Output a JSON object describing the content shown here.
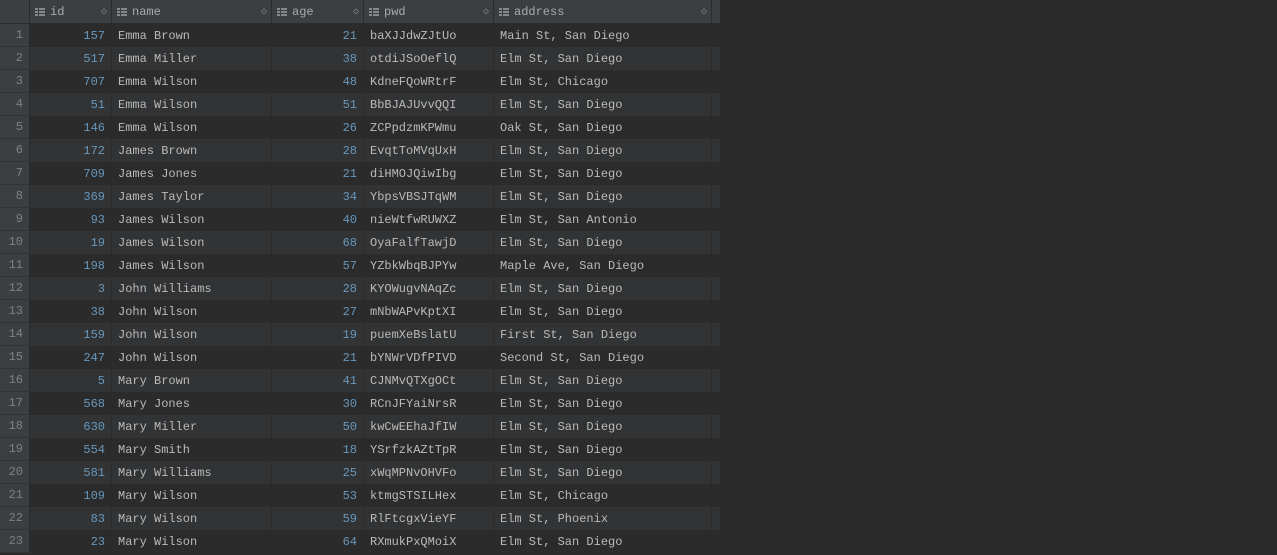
{
  "columns": {
    "id": "id",
    "name": "name",
    "age": "age",
    "pwd": "pwd",
    "address": "address"
  },
  "rows": [
    {
      "n": "1",
      "id": "157",
      "name": "Emma Brown",
      "age": "21",
      "pwd": "baXJJdwZJtUo",
      "address": "Main St, San Diego"
    },
    {
      "n": "2",
      "id": "517",
      "name": "Emma Miller",
      "age": "38",
      "pwd": "otdiJSoOeflQ",
      "address": "Elm St, San Diego"
    },
    {
      "n": "3",
      "id": "707",
      "name": "Emma Wilson",
      "age": "48",
      "pwd": "KdneFQoWRtrF",
      "address": "Elm St, Chicago"
    },
    {
      "n": "4",
      "id": "51",
      "name": "Emma Wilson",
      "age": "51",
      "pwd": "BbBJAJUvvQQI",
      "address": "Elm St, San Diego"
    },
    {
      "n": "5",
      "id": "146",
      "name": "Emma Wilson",
      "age": "26",
      "pwd": "ZCPpdzmKPWmu",
      "address": "Oak St, San Diego"
    },
    {
      "n": "6",
      "id": "172",
      "name": "James Brown",
      "age": "28",
      "pwd": "EvqtToMVqUxH",
      "address": "Elm St, San Diego"
    },
    {
      "n": "7",
      "id": "709",
      "name": "James Jones",
      "age": "21",
      "pwd": "diHMOJQiwIbg",
      "address": "Elm St, San Diego"
    },
    {
      "n": "8",
      "id": "369",
      "name": "James Taylor",
      "age": "34",
      "pwd": "YbpsVBSJTqWM",
      "address": "Elm St, San Diego"
    },
    {
      "n": "9",
      "id": "93",
      "name": "James Wilson",
      "age": "40",
      "pwd": "nieWtfwRUWXZ",
      "address": "Elm St, San Antonio"
    },
    {
      "n": "10",
      "id": "19",
      "name": "James Wilson",
      "age": "68",
      "pwd": "OyaFalfTawjD",
      "address": "Elm St, San Diego"
    },
    {
      "n": "11",
      "id": "198",
      "name": "James Wilson",
      "age": "57",
      "pwd": "YZbkWbqBJPYw",
      "address": "Maple Ave, San Diego"
    },
    {
      "n": "12",
      "id": "3",
      "name": "John Williams",
      "age": "28",
      "pwd": "KYOWugvNAqZc",
      "address": "Elm St, San Diego"
    },
    {
      "n": "13",
      "id": "38",
      "name": "John Wilson",
      "age": "27",
      "pwd": "mNbWAPvKptXI",
      "address": "Elm St, San Diego"
    },
    {
      "n": "14",
      "id": "159",
      "name": "John Wilson",
      "age": "19",
      "pwd": "puemXeBslatU",
      "address": "First St, San Diego"
    },
    {
      "n": "15",
      "id": "247",
      "name": "John Wilson",
      "age": "21",
      "pwd": "bYNWrVDfPIVD",
      "address": "Second St, San Diego"
    },
    {
      "n": "16",
      "id": "5",
      "name": "Mary Brown",
      "age": "41",
      "pwd": "CJNMvQTXgOCt",
      "address": "Elm St, San Diego"
    },
    {
      "n": "17",
      "id": "568",
      "name": "Mary Jones",
      "age": "30",
      "pwd": "RCnJFYaiNrsR",
      "address": "Elm St, San Diego"
    },
    {
      "n": "18",
      "id": "630",
      "name": "Mary Miller",
      "age": "50",
      "pwd": "kwCwEEhaJfIW",
      "address": "Elm St, San Diego"
    },
    {
      "n": "19",
      "id": "554",
      "name": "Mary Smith",
      "age": "18",
      "pwd": "YSrfzkAZtTpR",
      "address": "Elm St, San Diego"
    },
    {
      "n": "20",
      "id": "581",
      "name": "Mary Williams",
      "age": "25",
      "pwd": "xWqMPNvOHVFo",
      "address": "Elm St, San Diego"
    },
    {
      "n": "21",
      "id": "109",
      "name": "Mary Wilson",
      "age": "53",
      "pwd": "ktmgSTSILHex",
      "address": "Elm St, Chicago"
    },
    {
      "n": "22",
      "id": "83",
      "name": "Mary Wilson",
      "age": "59",
      "pwd": "RlFtcgxVieYF",
      "address": "Elm St, Phoenix"
    },
    {
      "n": "23",
      "id": "23",
      "name": "Mary Wilson",
      "age": "64",
      "pwd": "RXmukPxQMoiX",
      "address": "Elm St, San Diego"
    }
  ]
}
